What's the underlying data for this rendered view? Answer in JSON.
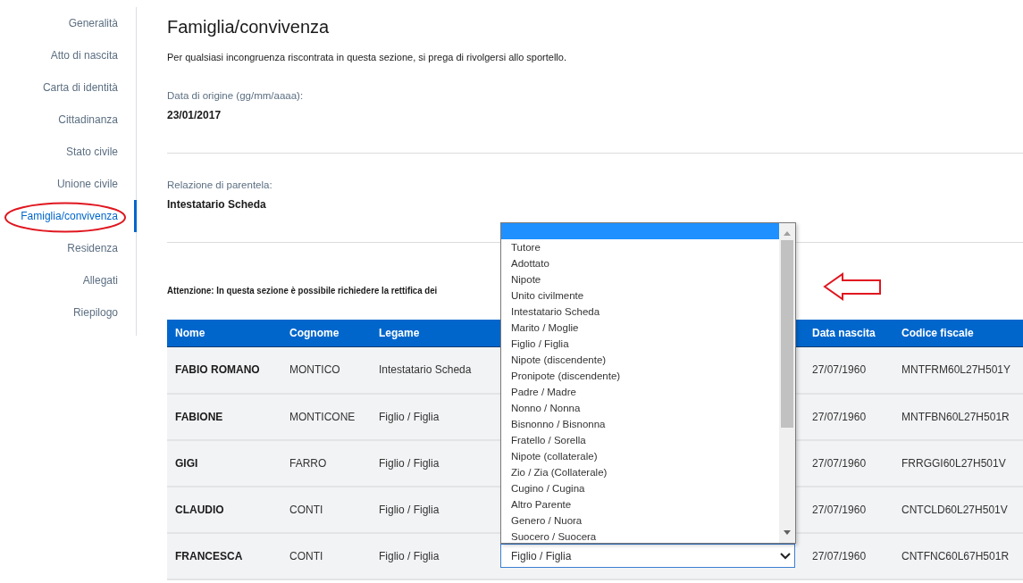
{
  "sidebar": {
    "items": [
      {
        "label": "Generalità",
        "selected": false
      },
      {
        "label": "Atto di nascita",
        "selected": false
      },
      {
        "label": "Carta di identità",
        "selected": false
      },
      {
        "label": "Cittadinanza",
        "selected": false
      },
      {
        "label": "Stato civile",
        "selected": false
      },
      {
        "label": "Unione civile",
        "selected": false
      },
      {
        "label": "Famiglia/convivenza",
        "selected": true
      },
      {
        "label": "Residenza",
        "selected": false
      },
      {
        "label": "Allegati",
        "selected": false
      },
      {
        "label": "Riepilogo",
        "selected": false
      }
    ]
  },
  "content": {
    "title": "Famiglia/convivenza",
    "notice": "Per qualsiasi incongruenza riscontrata in questa sezione, si prega di rivolgersi allo sportello.",
    "fields": [
      {
        "label": "Data di origine (gg/mm/aaaa):",
        "value": "23/01/2017"
      },
      {
        "label": "Relazione di parentela:",
        "value": "Intestatario Scheda"
      }
    ],
    "warning": "Attenzione: In questa sezione è possibile richiedere la rettifica dei"
  },
  "table": {
    "columns": [
      "Nome",
      "Cognome",
      "Legame",
      null,
      "Data nascita",
      "Codice fiscale"
    ],
    "rows": [
      {
        "cells": [
          "FABIO ROMANO",
          "MONTICO",
          "Intestatario Scheda",
          null,
          "27/07/1960",
          "MNTFRM60L27H501Y"
        ]
      },
      {
        "cells": [
          "FABIONE",
          "MONTICONE",
          "Figlio / Figlia",
          null,
          "27/07/1960",
          "MNTFBN60L27H501R"
        ]
      },
      {
        "cells": [
          "GIGI",
          "FARRO",
          "Figlio / Figlia",
          null,
          "27/07/1960",
          "FRRGGI60L27H501V"
        ]
      },
      {
        "cells": [
          "CLAUDIO",
          "CONTI",
          "Figlio / Figlia",
          null,
          "27/07/1960",
          "CNTCLD60L27H501V"
        ]
      },
      {
        "cells": [
          "FRANCESCA",
          "CONTI",
          "Figlio / Figlia",
          null,
          "27/07/1960",
          "CNTFNC60L67H501R"
        ],
        "select_value": "Figlio / Figlia"
      }
    ]
  },
  "dropdown": {
    "blank_option_highlighted": true,
    "options": [
      {
        "label": "Tutore",
        "selected": false
      },
      {
        "label": "Adottato",
        "selected": false
      },
      {
        "label": "Nipote",
        "selected": false
      },
      {
        "label": "Unito civilmente",
        "selected": false
      },
      {
        "label": "Intestatario Scheda",
        "selected": false
      },
      {
        "label": "Marito / Moglie",
        "selected": false
      },
      {
        "label": "Figlio / Figlia",
        "selected": false
      },
      {
        "label": "Nipote (discendente)",
        "selected": false
      },
      {
        "label": "Pronipote (discendente)",
        "selected": false
      },
      {
        "label": "Padre / Madre",
        "selected": false
      },
      {
        "label": "Nonno / Nonna",
        "selected": false
      },
      {
        "label": "Bisnonno / Bisnonna",
        "selected": false
      },
      {
        "label": "Fratello / Sorella",
        "selected": false
      },
      {
        "label": "Nipote (collaterale)",
        "selected": false
      },
      {
        "label": "Zio / Zia (Collaterale)",
        "selected": false
      },
      {
        "label": "Cugino / Cugina",
        "selected": false
      },
      {
        "label": "Altro Parente",
        "selected": false
      },
      {
        "label": "Genero / Nuora",
        "selected": false
      },
      {
        "label": "Suocero / Suocera",
        "selected": false
      }
    ]
  }
}
